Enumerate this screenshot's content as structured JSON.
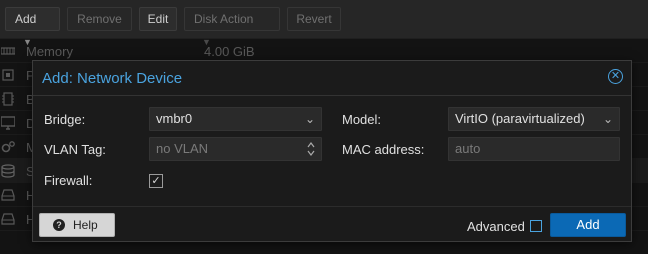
{
  "toolbar": {
    "add_label": "Add",
    "remove_label": "Remove",
    "edit_label": "Edit",
    "disk_action_label": "Disk Action",
    "revert_label": "Revert"
  },
  "hardware_list": {
    "rows": [
      {
        "key": "Memory",
        "value": "4.00 GiB",
        "icon": "memory-icon"
      },
      {
        "key": "P",
        "value": "",
        "icon": "cpu-icon"
      },
      {
        "key": "B",
        "value": "",
        "icon": "bios-icon"
      },
      {
        "key": "D",
        "value": "",
        "icon": "display-icon"
      },
      {
        "key": "M",
        "value": "",
        "icon": "machine-icon"
      },
      {
        "key": "S",
        "value": "",
        "icon": "storage-icon"
      },
      {
        "key": "H",
        "value": "",
        "icon": "hard-disk-icon"
      },
      {
        "key": "H",
        "value": "",
        "icon": "hard-disk-icon"
      }
    ]
  },
  "dialog": {
    "title": "Add: Network Device",
    "fields": {
      "bridge_label": "Bridge:",
      "bridge_value": "vmbr0",
      "model_label": "Model:",
      "model_value": "VirtIO (paravirtualized)",
      "vlan_label": "VLAN Tag:",
      "vlan_placeholder": "no VLAN",
      "mac_label": "MAC address:",
      "mac_placeholder": "auto",
      "firewall_label": "Firewall:",
      "firewall_checked": true
    },
    "footer": {
      "help_label": "Help",
      "advanced_label": "Advanced",
      "advanced_checked": false,
      "add_label": "Add"
    }
  },
  "colors": {
    "accent": "#4aa3df",
    "primary_button": "#0b69b5"
  }
}
